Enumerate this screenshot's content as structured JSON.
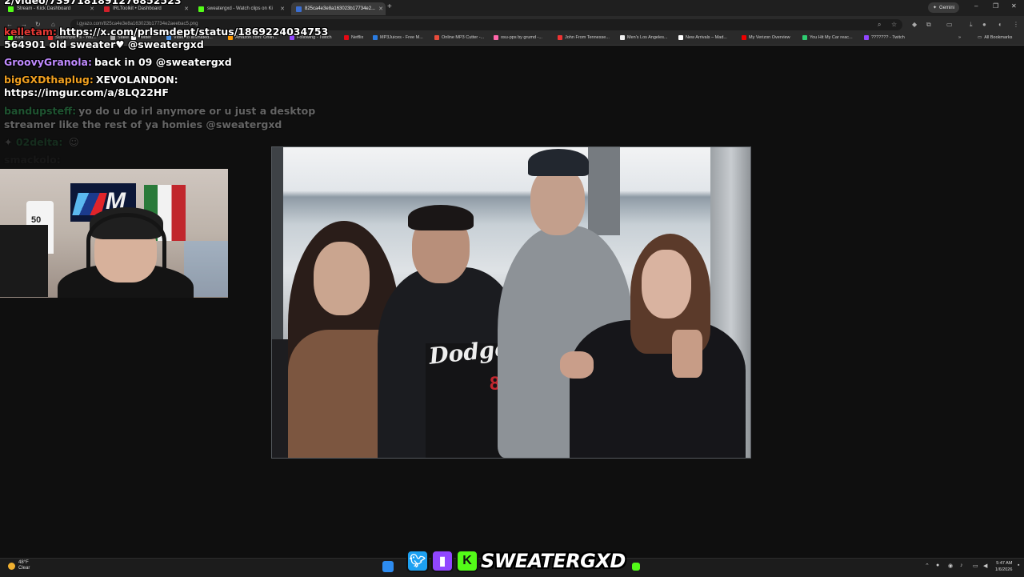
{
  "browser": {
    "tabs": [
      {
        "label": "Stream - Kick Dashboard",
        "color": "#53fc18"
      },
      {
        "label": "IRLToolkit • Dashboard",
        "color": "#d0202a"
      },
      {
        "label": "sweatergxd - Watch clips on Ki",
        "color": "#53fc18"
      },
      {
        "label": "825ca4e3e8a163023b17734e2...",
        "color": "#3b6ed1"
      }
    ],
    "gemini_label": "Gemini",
    "url": "i.gyazo.com/825ca4e3e8a163023b17734e2aeebac5.png",
    "bookmarks": [
      {
        "label": "Kick",
        "color": "#53fc18"
      },
      {
        "label": "Subscriptions - You...",
        "color": "#e33"
      },
      {
        "label": "Stake",
        "color": "#aaa"
      },
      {
        "label": "Twitter",
        "color": "#fff"
      },
      {
        "label": "Video to animated...",
        "color": "#4a90e2"
      },
      {
        "label": "Amazon.com: Onlin...",
        "color": "#ff9900"
      },
      {
        "label": "Following - Twitch",
        "color": "#9146ff"
      },
      {
        "label": "Netflix",
        "color": "#e50914"
      },
      {
        "label": "MP3Juices - Free M...",
        "color": "#2a7be0"
      },
      {
        "label": "Online MP3 Cutter -...",
        "color": "#e74c3c"
      },
      {
        "label": "osu-pps by grumd -...",
        "color": "#ff66aa"
      },
      {
        "label": "John From Tennesse...",
        "color": "#e33"
      },
      {
        "label": "Men's Los Angeles...",
        "color": "#eee"
      },
      {
        "label": "New Arrivals – Mad...",
        "color": "#fff"
      },
      {
        "label": "My Verizon Overview",
        "color": "#e00"
      },
      {
        "label": "You Hit My Car reac...",
        "color": "#2ecc71"
      },
      {
        "label": "??????? - Twitch",
        "color": "#9146ff"
      }
    ],
    "all_bookmarks": "All Bookmarks"
  },
  "chat": {
    "top_partial": "2/video/7397181891276852523",
    "lines": [
      {
        "user": "kelletam:",
        "user_color": "#e53935",
        "text": "https://x.com/prlsmdept/status/1869224034753"
      },
      {
        "user": "",
        "user_color": "#ffffff",
        "text": "564901 old sweater♥ @sweatergxd"
      },
      {
        "user": "GroovyGranola:",
        "user_color": "#c08bff",
        "text": "back in 09 @sweatergxd"
      },
      {
        "user": "bigGXDthaplug:",
        "user_color": "#f0a020",
        "text": "XEVOLANDON:"
      },
      {
        "user": "",
        "user_color": "#ffffff",
        "text": "https://imgur.com/a/8LQ22HF"
      },
      {
        "user": "bandupsteff:",
        "user_color": "#3bd16f",
        "text": "yo do u do irl anymore or u just a desktop"
      },
      {
        "user": "",
        "user_color": "#ffffff",
        "text": "streamer like the rest of ya homies @sweatergxd"
      },
      {
        "user": "02delta:",
        "user_color": "#3bd16f",
        "text": ""
      },
      {
        "user": "smackolo:",
        "user_color": "#888888",
        "text": ""
      }
    ]
  },
  "webcam": {
    "jersey_number": "50"
  },
  "photo": {
    "shirt_text": "Dodgers",
    "shirt_number": "8"
  },
  "overlay": {
    "brand_name": "SWEATERGXD",
    "twitter_color": "#1da1f2",
    "twitch_color": "#9146ff",
    "kick_color": "#53fc18"
  },
  "taskbar": {
    "weather_temp": "48°F",
    "weather_desc": "Clear",
    "time": "5:47 AM",
    "date": "1/6/2026"
  }
}
